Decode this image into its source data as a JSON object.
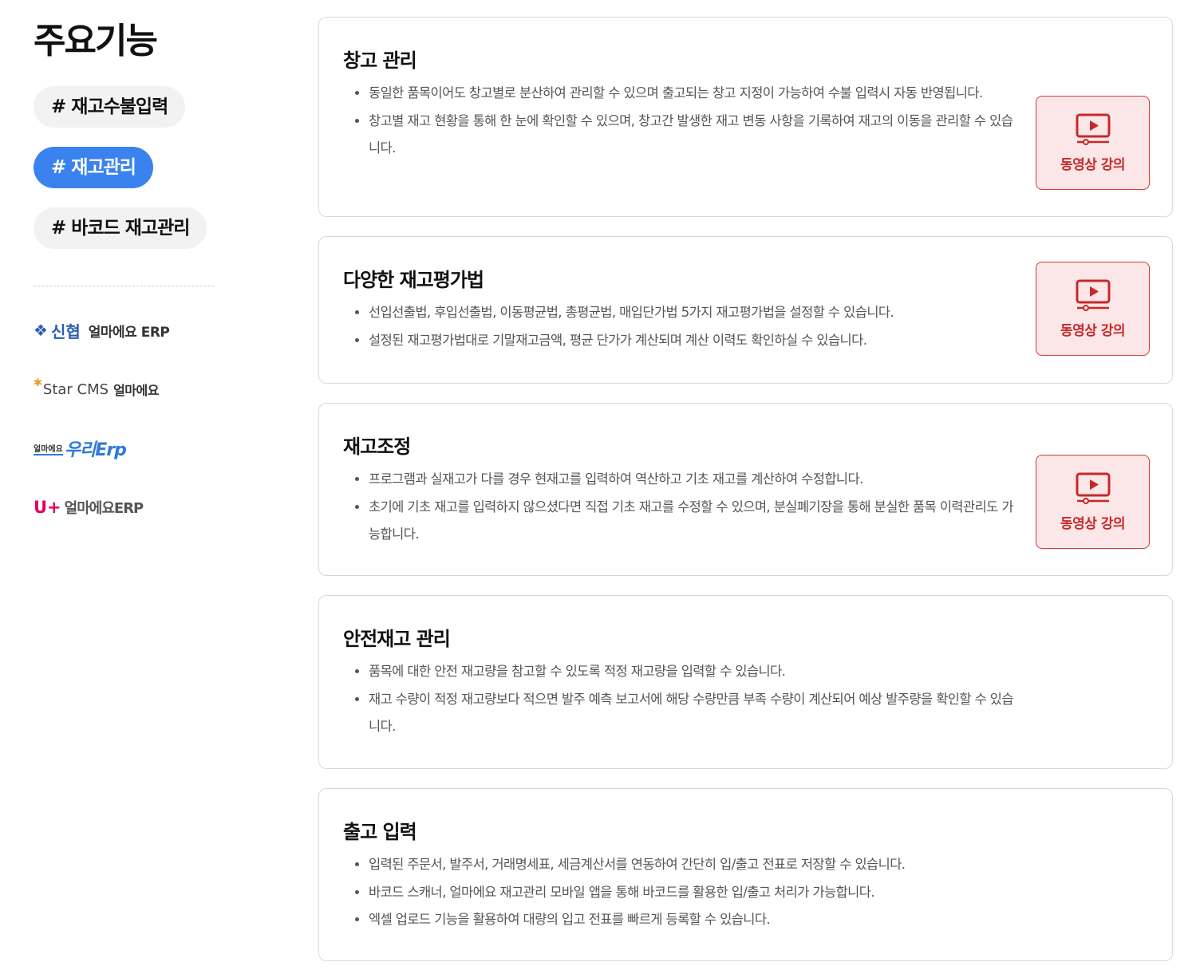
{
  "sidebar": {
    "title": "주요기능",
    "tags": [
      {
        "label": "# 재고수불입력",
        "active": false
      },
      {
        "label": "# 재고관리",
        "active": true
      },
      {
        "label": "# 바코드 재고관리",
        "active": false
      }
    ],
    "partners": {
      "shinhyup": {
        "brand": "신협",
        "product": "얼마에요 ERP"
      },
      "starcms": {
        "brand": "Star CMS",
        "product": "얼마에요"
      },
      "uri": {
        "small": "얼마에요",
        "brand": "우리Erp"
      },
      "uplus": {
        "brand": "U+",
        "product": "얼마에요ERP"
      }
    }
  },
  "cards": [
    {
      "title": "창고 관리",
      "items": [
        "동일한 품목이어도 창고별로 분산하여 관리할 수 있으며 출고되는 창고 지정이 가능하여 수불 입력시 자동 반영됩니다.",
        "창고별 재고 현황을 통해 한 눈에 확인할 수 있으며, 창고간 발생한 재고 변동 사항을 기록하여 재고의 이동을 관리할 수 있습니다."
      ],
      "video_label": "동영상 강의"
    },
    {
      "title": "다양한 재고평가법",
      "items": [
        "선입선출법, 후입선출법, 이동평균법, 총평균법, 매입단가법 5가지 재고평가법을 설정할 수 있습니다.",
        "설정된 재고평가법대로 기말재고금액, 평균 단가가 계산되며 계산 이력도 확인하실 수 있습니다."
      ],
      "video_label": "동영상 강의"
    },
    {
      "title": "재고조정",
      "items": [
        "프로그램과 실재고가 다를 경우 현재고를 입력하여 역산하고 기초 재고를 계산하여 수정합니다.",
        "초기에 기초 재고를 입력하지 않으셨다면 직접 기초 재고를 수정할 수 있으며, 분실폐기장을 통해 분실한 품목 이력관리도 가능합니다."
      ],
      "video_label": "동영상 강의"
    },
    {
      "title": "안전재고 관리",
      "items": [
        "품목에 대한 안전 재고량을 참고할 수 있도록 적정 재고량을 입력할 수 있습니다.",
        "재고 수량이 적정 재고량보다 적으면 발주 예측 보고서에 해당 수량만큼 부족 수량이 계산되어 예상 발주량을 확인할 수 있습니다."
      ]
    },
    {
      "title": "출고 입력",
      "items": [
        "입력된 주문서, 발주서, 거래명세표, 세금계산서를 연동하여 간단히 입/출고 전표로 저장할 수 있습니다.",
        "바코드 스캐너, 얼마에요 재고관리 모바일 앱을 통해 바코드를 활용한 입/출고 처리가 가능합니다.",
        "엑셀 업로드 기능을 활용하여 대량의 입고 전표를 빠르게 등록할 수 있습니다."
      ]
    }
  ],
  "colors": {
    "accent": "#3a83ee",
    "video_border": "#d23a3a",
    "video_bg": "#fbe7e7",
    "video_text": "#c7282a"
  },
  "icons": {
    "video": "video-lecture-icon",
    "shinhyup_logo": "shinhyup-emblem-icon",
    "star": "star-icon"
  }
}
